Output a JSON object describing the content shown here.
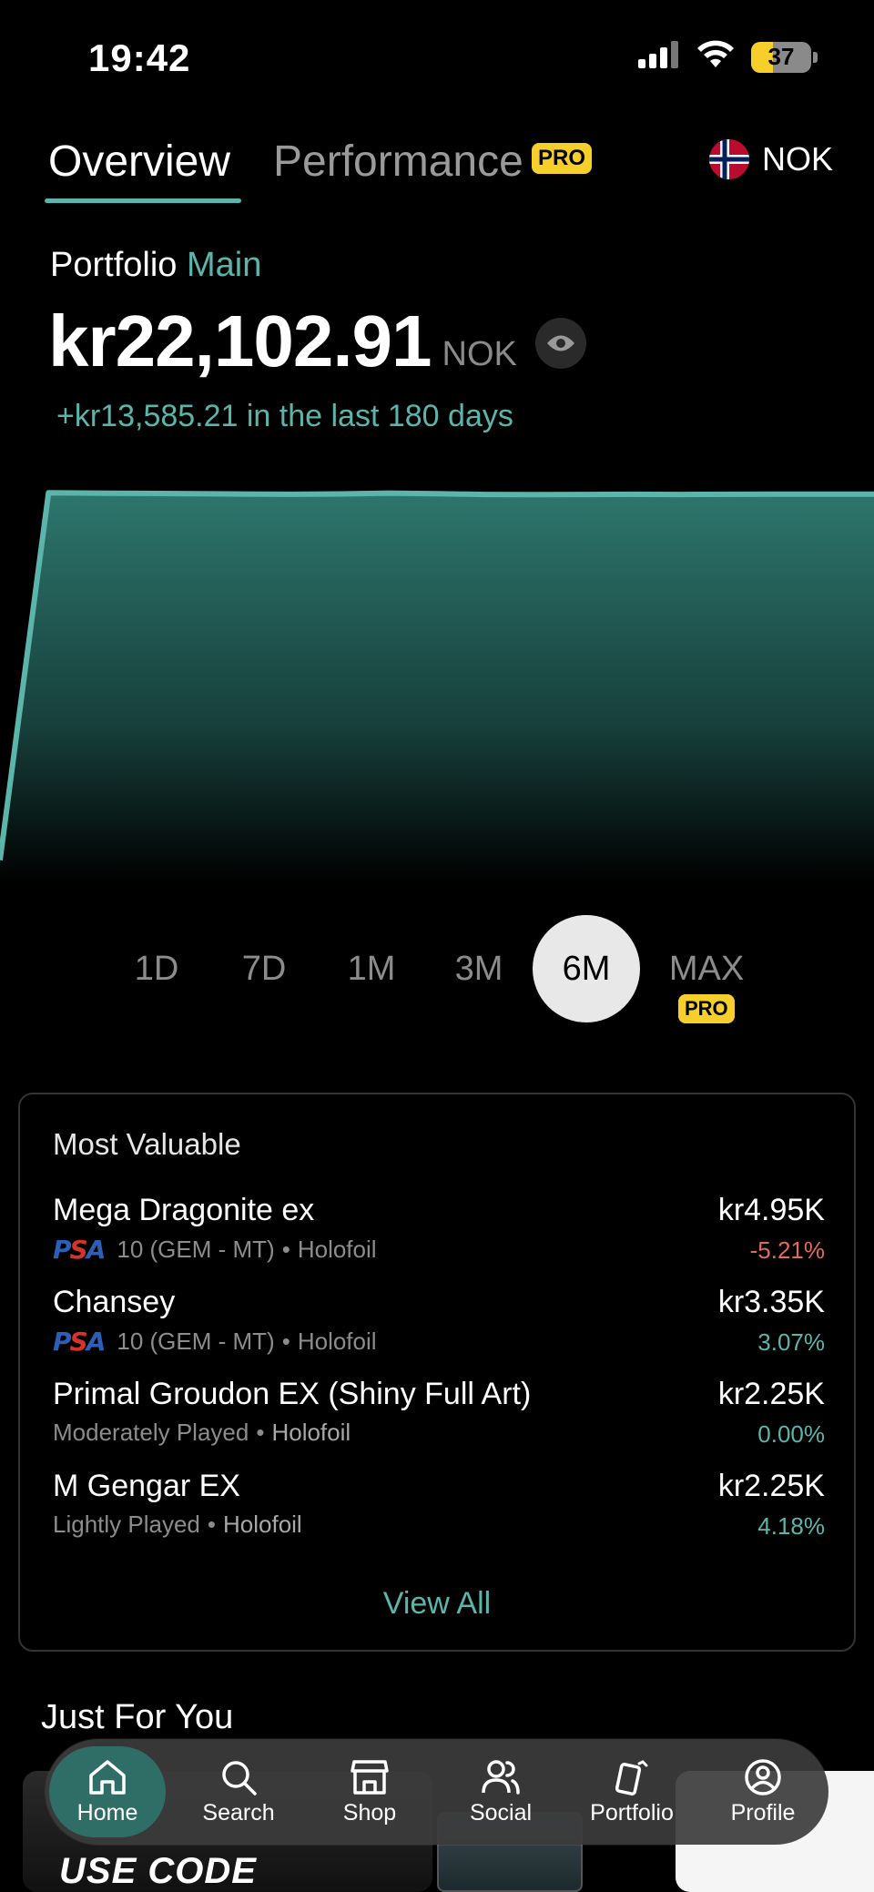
{
  "status_bar": {
    "time": "19:42",
    "battery": "37"
  },
  "tabs": {
    "overview": "Overview",
    "performance": "Performance",
    "pro": "PRO"
  },
  "currency": {
    "code": "NOK",
    "flag": "norway-flag"
  },
  "portfolio": {
    "label": "Portfolio",
    "name": "Main",
    "value": "kr22,102.91",
    "value_currency": "NOK",
    "change_text": "+kr13,585.21 in the last 180 days"
  },
  "chart_data": {
    "type": "area",
    "x": [
      0,
      10,
      20,
      30,
      40,
      50,
      60,
      70,
      80,
      90,
      100,
      110,
      120,
      130,
      140,
      150,
      160,
      170,
      180
    ],
    "y": [
      8517,
      22150,
      22140,
      22130,
      22120,
      22105,
      22095,
      22110,
      22140,
      22120,
      22090,
      22085,
      22090,
      22095,
      22090,
      22095,
      22100,
      22102,
      22103
    ],
    "ylim": [
      8000,
      22600
    ],
    "line_color": "#5bb5ab",
    "fill_color": "#2a6e66",
    "grid": false
  },
  "ranges": {
    "items": [
      "1D",
      "7D",
      "1M",
      "3M",
      "6M",
      "MAX"
    ],
    "selected": "6M",
    "max_badge": "PRO"
  },
  "most_valuable": {
    "title": "Most Valuable",
    "items": [
      {
        "name": "Mega Dragonite ex",
        "grader": "PSA",
        "grade": "10 (GEM - MT)",
        "sep": "•",
        "variant": "Holofoil",
        "price": "kr4.95K",
        "change": "-5.21%"
      },
      {
        "name": "Chansey",
        "grader": "PSA",
        "grade": "10 (GEM - MT)",
        "sep": "•",
        "variant": "Holofoil",
        "price": "kr3.35K",
        "change": "3.07%"
      },
      {
        "name": "Primal Groudon EX (Shiny Full Art)",
        "condition": "Moderately Played",
        "sep": "•",
        "variant": "Holofoil",
        "price": "kr2.25K",
        "change": "0.00%"
      },
      {
        "name": "M Gengar EX",
        "condition": "Lightly Played",
        "sep": "•",
        "variant": "Holofoil",
        "price": "kr2.25K",
        "change": "4.18%"
      }
    ],
    "view_all": "View All"
  },
  "just_for_you": {
    "title": "Just For You",
    "promo_text": "USE CODE"
  },
  "nav": {
    "items": [
      {
        "label": "Home",
        "icon": "home-icon"
      },
      {
        "label": "Search",
        "icon": "search-icon"
      },
      {
        "label": "Shop",
        "icon": "shop-icon"
      },
      {
        "label": "Social",
        "icon": "social-icon"
      },
      {
        "label": "Portfolio",
        "icon": "portfolio-icon"
      },
      {
        "label": "Profile",
        "icon": "profile-icon"
      }
    ],
    "active": "Home"
  }
}
